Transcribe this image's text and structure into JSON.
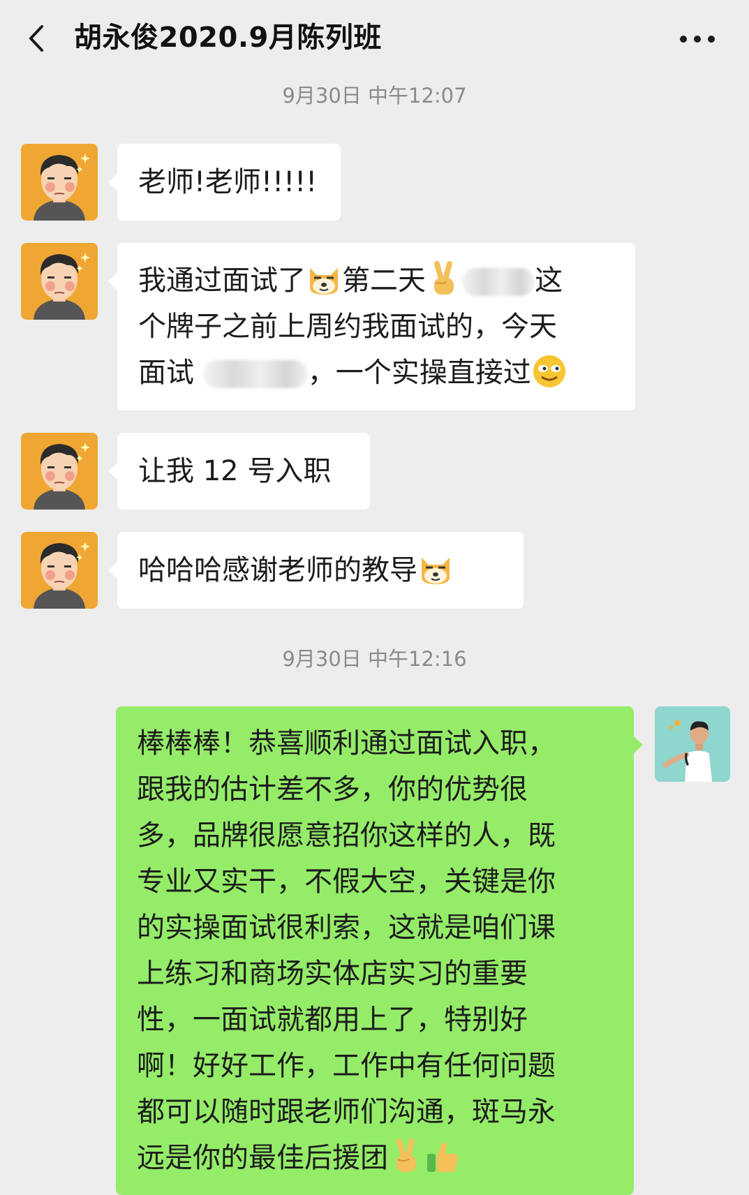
{
  "header": {
    "title": "胡永俊2020.9月陈列班"
  },
  "timestamps": [
    "9月30日 中午12:07",
    "9月30日 中午12:16"
  ],
  "messages": [
    {
      "from": "student",
      "lines": [
        "老师!老师!!!!!"
      ]
    },
    {
      "from": "student",
      "lines": [
        "我通过面试了",
        "第二天",
        "这",
        "个牌子之前上周约我面试的，今天",
        "面试",
        "，一个实操直接过"
      ]
    },
    {
      "from": "student",
      "lines": [
        "让我 12 号入职"
      ]
    },
    {
      "from": "student",
      "lines": [
        "哈哈哈感谢老师的教导"
      ]
    },
    {
      "from": "teacher",
      "lines": [
        "棒棒棒！恭喜顺利通过面试入职，",
        "跟我的估计差不多，你的优势很",
        "多，品牌很愿意招你这样的人，既",
        "专业又实干，不假大空，关键是你",
        "的实操面试很利索，这就是咱们课",
        "上练习和商场实体店实习的重要",
        "性，一面试就都用上了，特别好",
        "啊！好好工作，工作中有任何问题",
        "都可以随时跟老师们沟通，斑马永",
        "远是你的最佳后援团"
      ]
    }
  ],
  "icons": {
    "back": "chevron-left-icon",
    "more": "more-dots-icon",
    "emoji_doge": "doge-emoji-icon",
    "emoji_victory": "victory-hand-emoji-icon",
    "emoji_smile": "smirk-emoji-icon",
    "emoji_thumbs": "thumbs-up-emoji-icon"
  },
  "colors": {
    "background": "#ededed",
    "incoming_bubble": "#ffffff",
    "outgoing_bubble": "#95ec69",
    "timestamp": "#8a8a8a"
  }
}
